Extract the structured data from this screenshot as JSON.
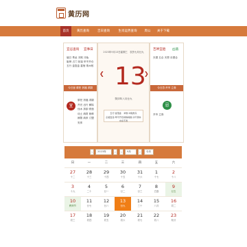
{
  "site": {
    "name": "黄历网"
  },
  "nav": {
    "items": [
      "首页",
      "黄历查询",
      "吉日查询",
      "生肖运势查询",
      "周公",
      "关于下载"
    ]
  },
  "left_panel": {
    "labels": [
      "宜忌查询",
      "宜事日"
    ],
    "rows": [
      [
        "值日",
        "青龙",
        "冲煞",
        "冲兔"
      ],
      [
        "胎神",
        "占门",
        "彭祖",
        "甲不开仓"
      ],
      [
        "五行",
        "金箔金",
        "星宿",
        "角木蛟"
      ]
    ],
    "header": "今日宜:祭祀 祈福 求嗣",
    "yi_char": "宜",
    "yi_items": [
      [
        "祭祀",
        "祈福",
        "求嗣",
        "开光"
      ],
      [
        "出行",
        "解除",
        "伐木",
        "拆卸"
      ],
      [
        "修造",
        "动土",
        "纳财",
        "栽种"
      ],
      [
        "嫁娶",
        "纳采",
        "订盟",
        "安床"
      ]
    ]
  },
  "center": {
    "date_line": "2023年9月13日星期三　农历七月廿九",
    "day": "13",
    "lunar_line": "癸卯年八月廿九",
    "info_line1": "五行:金箔金　冲煞:冲兔煞东",
    "info_line2": "彭祖百忌:甲不开仓财物耗散 卯不穿井水泉不香"
  },
  "right_panel": {
    "labels": [
      "吉神宜趋",
      "凶煞"
    ],
    "rows": [
      [
        "天德",
        "五合",
        "天恩",
        "月德合"
      ],
      [
        "",
        "",
        "",
        ""
      ]
    ],
    "header": "今日忌:开市 立券",
    "ji_char": "忌",
    "ji_items": [
      [
        "开市",
        "立券"
      ]
    ]
  },
  "calendar": {
    "year": "2023年",
    "month": "9月",
    "today_button": "今天",
    "weekdays": [
      "日",
      "一",
      "二",
      "三",
      "四",
      "五",
      "六"
    ],
    "weeks": [
      [
        [
          "27",
          "十二"
        ],
        [
          "28",
          "十三"
        ],
        [
          "29",
          "十四"
        ],
        [
          "30",
          "十五"
        ],
        [
          "31",
          "十六"
        ],
        [
          "1",
          "十七"
        ],
        [
          "2",
          "十八"
        ]
      ],
      [
        [
          "3",
          "十九"
        ],
        [
          "4",
          "二十"
        ],
        [
          "5",
          "廿一"
        ],
        [
          "6",
          "廿二"
        ],
        [
          "7",
          "廿三"
        ],
        [
          "8",
          "白露"
        ],
        [
          "9",
          "廿五"
        ]
      ],
      [
        [
          "10",
          "教师节"
        ],
        [
          "11",
          "廿七"
        ],
        [
          "12",
          "廿八"
        ],
        [
          "13",
          "廿九"
        ],
        [
          "14",
          "三十"
        ],
        [
          "15",
          "八月"
        ],
        [
          "16",
          "初二"
        ]
      ],
      [
        [
          "17",
          "初三"
        ],
        [
          "18",
          "初四"
        ],
        [
          "19",
          "初五"
        ],
        [
          "20",
          "初六"
        ],
        [
          "21",
          "初七"
        ],
        [
          "22",
          "初八"
        ],
        [
          "23",
          "秋分"
        ]
      ]
    ]
  },
  "colors": {
    "nav": "#d67a3c",
    "active": "#a83228",
    "red": "#b3281e",
    "green": "#2e8f47",
    "today": "#f07e16"
  }
}
